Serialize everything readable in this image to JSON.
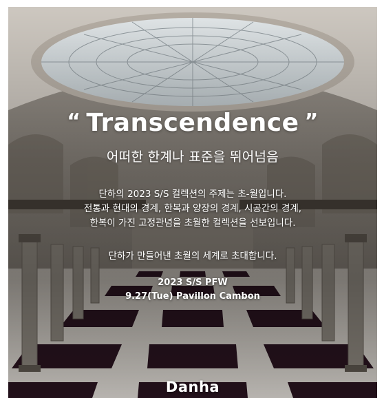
{
  "poster": {
    "title": "Transcendence",
    "quote_open": "“",
    "quote_close": "”",
    "subtitle": "어떠한 한계나 표준을 뛰어넘음",
    "description_lines": [
      "단하의 2023 S/S 컬렉션의 주제는 초-월입니다.",
      "전통과 현대의 경계, 한복과 양장의 경계, 시공간의 경계,",
      "한복이 가진 고정관념을 초월한 컬렉션을 선보입니다."
    ],
    "invitation": "단하가 만들어낸 초월의 세계로 초대합니다.",
    "event_lines": [
      "2023 S/S PFW",
      "9.27(Tue) Pavillon Cambon"
    ],
    "brand": "Danha"
  },
  "colors": {
    "text": "#ffffff",
    "floor_dark": "#2a1420",
    "floor_light": "#e8e4de",
    "skylight": "#dfe6ea"
  }
}
